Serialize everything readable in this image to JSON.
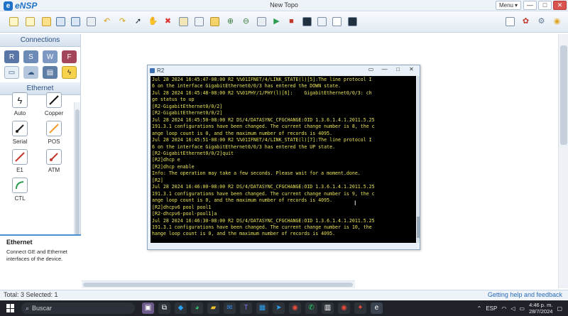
{
  "app": {
    "name": "eNSP",
    "window_title": "New Topo",
    "menu_label": "Menu",
    "colors": {
      "accent": "#1e73c8",
      "terminal_bg": "#000000",
      "terminal_text": "#e8e35a",
      "close": "#d9534f"
    }
  },
  "left_panel": {
    "connections_header": "Connections",
    "device_icons": [
      "router-icon",
      "switch-icon",
      "wireless-icon",
      "firewall-icon",
      "pc-icon",
      "cloud-icon",
      "server-icon",
      "cable-icon"
    ],
    "ethernet_header": "Ethernet",
    "cables": [
      {
        "label": "Auto",
        "icon": "auto-cable-icon",
        "color": "#222222"
      },
      {
        "label": "Copper",
        "icon": "copper-cable-icon",
        "color": "#111111"
      },
      {
        "label": "Serial",
        "icon": "serial-cable-icon",
        "color": "#222222"
      },
      {
        "label": "POS",
        "icon": "pos-cable-icon",
        "color": "#f29b2a"
      },
      {
        "label": "E1",
        "icon": "e1-cable-icon",
        "color": "#c0392b"
      },
      {
        "label": "ATM",
        "icon": "atm-cable-icon",
        "color": "#c0392b"
      },
      {
        "label": "CTL",
        "icon": "ctl-cable-icon",
        "color": "#2e9d4f"
      }
    ],
    "description": {
      "title": "Ethernet",
      "text": "Connect GE and Ethernet interfaces of the device."
    }
  },
  "terminal": {
    "title": "R2",
    "lines": [
      "Jul 28 2024 16:45:47-08:00 R2 %%01IFNET/4/LINK_STATE(l)[5]:The line protocol I",
      "6 on the interface GigabitEthernet0/0/3 has entered the DOWN state.",
      "Jul 28 2024 16:45:48-08:00 R2 %%01PHY/1/PHY(l)[6]:    GigabitEthernet0/0/3: ch",
      "ge status to up",
      "[R2-GigabitEthernet0/0/2]",
      "[R2-GigabitEthernet0/0/2]",
      "Jul 28 2024 16:45:50-08:00 R2 DS/4/DATASYNC_CFGCHANGE:OID 1.3.6.1.4.1.2011.5.25",
      "191.3.1 configurations have been changed. The current change number is 8, the c",
      "ange loop count is 0, and the maximum number of records is 4095.",
      "Jul 28 2024 16:45:51-08:00 R2 %%01IFNET/4/LINK_STATE(l)[7]:The line protocol I",
      "6 on the interface GigabitEthernet0/0/3 has entered the UP state.",
      "[R2-GigabitEthernet0/0/2]quit",
      "[R2]dhcp e",
      "[R2]dhcp enable",
      "Info: The operation may take a few seconds. Please wait for a moment.done.",
      "[R2]",
      "Jul 28 2024 16:46:00-08:00 R2 DS/4/DATASYNC_CFGCHANGE:OID 1.3.6.1.4.1.2011.5.25",
      "191.3.1 configurations have been changed. The current change number is 9, the c",
      "ange loop count is 0, and the maximum number of records is 4095.",
      "[R2]dhcpv6 pool pool1",
      "[R2-dhcpv6-pool-pool1]a",
      "Jul 28 2024 16:46:30-08:00 R2 DS/4/DATASYNC_CFGCHANGE:OID 1.3.6.1.4.1.2011.5.25",
      "191.3.1 configurations have been changed. The current change number is 10, the",
      "hange loop count is 0, and the maximum number of records is 4095."
    ]
  },
  "status_bar": {
    "left": "Total: 3  Selected: 1",
    "right": "Getting help and feedback"
  },
  "taskbar": {
    "search_placeholder": "Buscar",
    "language": "ESP",
    "time": "4:46 p. m.",
    "date": "28/7/2024"
  }
}
